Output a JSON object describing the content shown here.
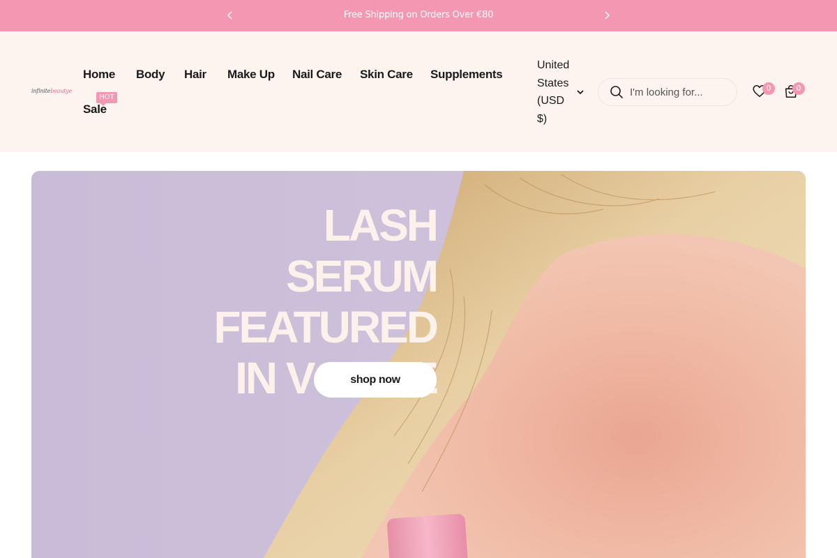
{
  "announcement": {
    "text": "Free Shipping on Orders Over €80",
    "prev_icon": "chevron-left-icon",
    "next_icon": "chevron-right-icon"
  },
  "header": {
    "logo": {
      "part1": "infinite",
      "part2": "beautye"
    },
    "nav": [
      {
        "label": "Home"
      },
      {
        "label": "Body"
      },
      {
        "label": "Hair"
      },
      {
        "label": "Make Up"
      },
      {
        "label": "Nail Care"
      },
      {
        "label": "Skin Care"
      },
      {
        "label": "Supplements"
      },
      {
        "label": "Sale",
        "badge": "HOT"
      }
    ],
    "currency": {
      "label": "United States (USD $)",
      "icon": "chevron-down-icon"
    },
    "search": {
      "placeholder": "I'm looking for...",
      "icon": "search-icon"
    },
    "wishlist": {
      "icon": "heart-icon",
      "count": "0"
    },
    "cart": {
      "icon": "shopping-bag-icon",
      "count": "0"
    }
  },
  "hero": {
    "title": "LASH SERUM FEATURED IN VOGUE",
    "cta_label": "shop now"
  },
  "colors": {
    "accent_pink": "#f497b2",
    "header_bg": "#fdf4f0",
    "hero_lavender": "#cbbfda",
    "hero_title": "#fdf1ec"
  }
}
